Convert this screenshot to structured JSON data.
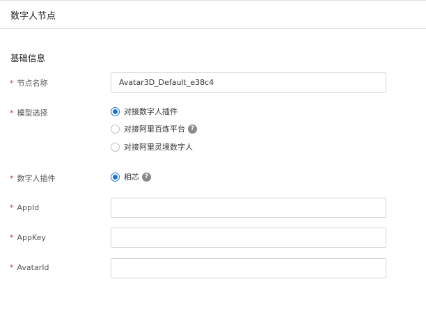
{
  "header": {
    "title": "数字人节点"
  },
  "section": {
    "title": "基础信息"
  },
  "fields": {
    "node_name": {
      "required_mark": "*",
      "label": "节点名称",
      "value": "Avatar3D_Default_e38c4"
    },
    "model_select": {
      "required_mark": "*",
      "label": "模型选择",
      "options": [
        {
          "label": "对接数字人插件",
          "checked": true
        },
        {
          "label": "对接阿里百炼平台",
          "checked": false,
          "help_icon": "?"
        },
        {
          "label": "对接阿里灵境数字人",
          "checked": false
        }
      ]
    },
    "plugin": {
      "required_mark": "*",
      "label": "数字人插件",
      "options": [
        {
          "label": "相芯",
          "checked": true,
          "help_icon": "?"
        }
      ]
    },
    "app_id": {
      "required_mark": "*",
      "label": "AppId",
      "value": ""
    },
    "app_key": {
      "required_mark": "*",
      "label": "AppKey",
      "value": ""
    },
    "avatar_id": {
      "required_mark": "*",
      "label": "AvatarId",
      "value": ""
    }
  },
  "colors": {
    "accent": "#1a73d9",
    "required": "#e0363a",
    "border": "#d6d6d6"
  }
}
